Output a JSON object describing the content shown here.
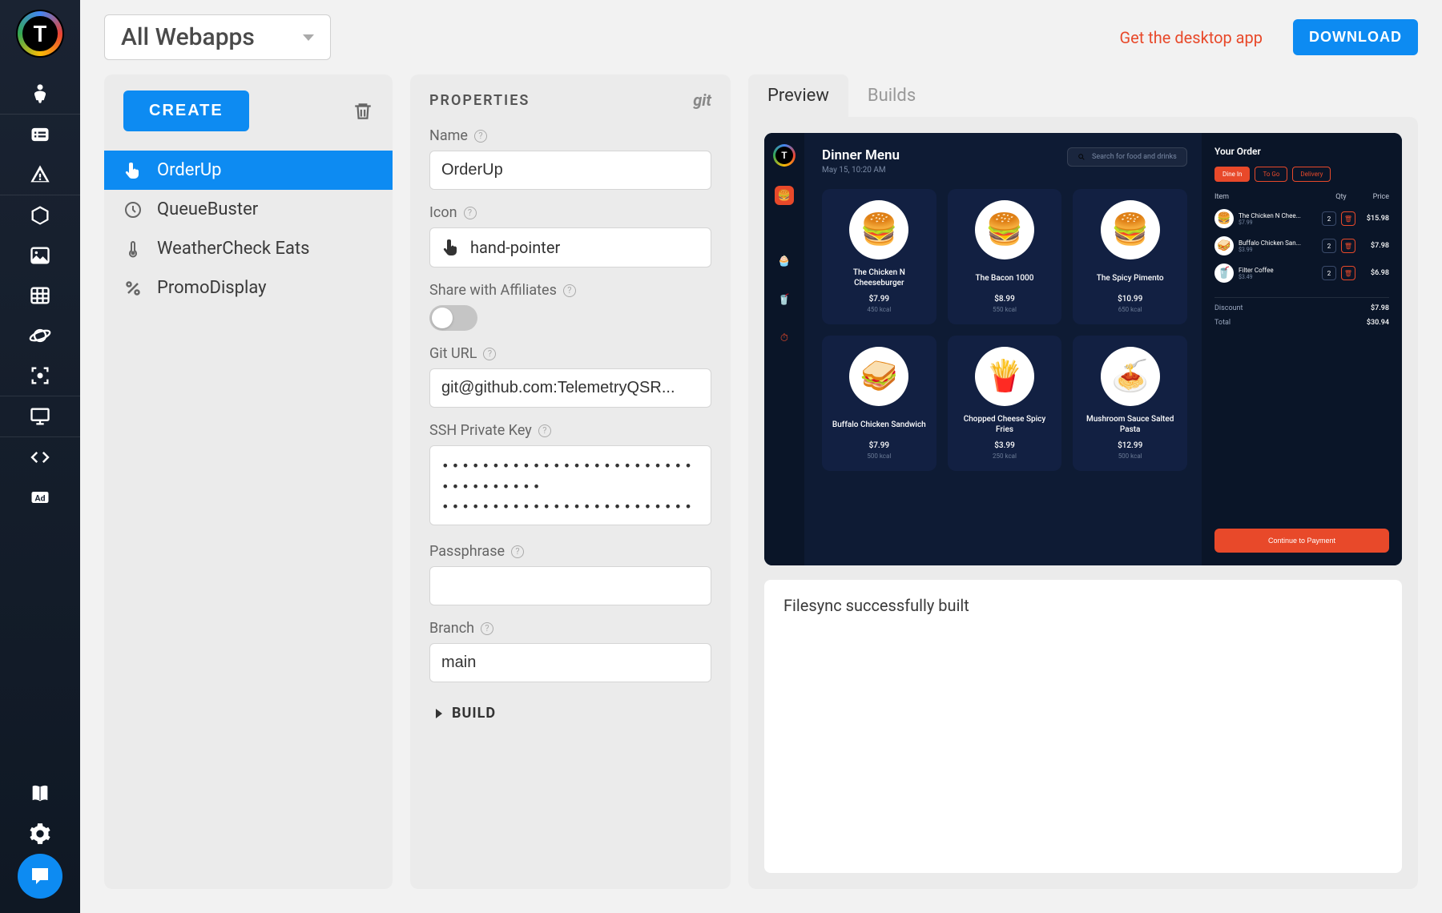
{
  "topbar": {
    "dropdown_label": "All Webapps",
    "desktop_link": "Get the desktop app",
    "download_btn": "DOWNLOAD"
  },
  "applist": {
    "create_btn": "CREATE",
    "items": [
      {
        "icon": "hand-pointer",
        "label": "OrderUp",
        "active": true
      },
      {
        "icon": "clock",
        "label": "QueueBuster"
      },
      {
        "icon": "thermometer",
        "label": "WeatherCheck Eats"
      },
      {
        "icon": "percent",
        "label": "PromoDisplay"
      }
    ]
  },
  "properties": {
    "title": "PROPERTIES",
    "git_label": "git",
    "name_label": "Name",
    "name_value": "OrderUp",
    "icon_label": "Icon",
    "icon_value": "hand-pointer",
    "share_label": "Share with Affiliates",
    "giturl_label": "Git URL",
    "giturl_value": "git@github.com:TelemetryQSR...",
    "ssh_label": "SSH Private Key",
    "ssh_value": "•••••••••••••••••••••••••••••••••••\n•••••••••••••••••••••••••••••••••••\n••••••••••••••••••••••••••••",
    "passphrase_label": "Passphrase",
    "passphrase_value": "",
    "branch_label": "Branch",
    "branch_value": "main",
    "build_label": "BUILD"
  },
  "preview": {
    "tabs": [
      {
        "label": "Preview",
        "active": true
      },
      {
        "label": "Builds"
      }
    ],
    "status_message": "Filesync successfully built",
    "app": {
      "title": "Dinner Menu",
      "date": "May 15, 10:20 AM",
      "search_placeholder": "Search for food and drinks",
      "menu": [
        {
          "emoji": "🍔",
          "name": "The Chicken N Cheeseburger",
          "price": "$7.99",
          "kcal": "450 kcal"
        },
        {
          "emoji": "🍔",
          "name": "The Bacon 1000",
          "price": "$8.99",
          "kcal": "550 kcal"
        },
        {
          "emoji": "🍔",
          "name": "The Spicy Pimento",
          "price": "$10.99",
          "kcal": "650 kcal"
        },
        {
          "emoji": "🥪",
          "name": "Buffalo Chicken Sandwich",
          "price": "$7.99",
          "kcal": "500 kcal"
        },
        {
          "emoji": "🍟",
          "name": "Chopped Cheese Spicy Fries",
          "price": "$3.99",
          "kcal": "250 kcal"
        },
        {
          "emoji": "🍝",
          "name": "Mushroom Sauce Salted Pasta",
          "price": "$12.99",
          "kcal": "500 kcal"
        }
      ],
      "order": {
        "title": "Your Order",
        "tabs": [
          {
            "label": "Dine In",
            "active": true
          },
          {
            "label": "To Go"
          },
          {
            "label": "Delivery"
          }
        ],
        "head_item": "Item",
        "head_qty": "Qty",
        "head_price": "Price",
        "items": [
          {
            "emoji": "🍔",
            "name": "The Chicken N Chee...",
            "sub": "$7.99",
            "qty": "2",
            "price": "$15.98"
          },
          {
            "emoji": "🥪",
            "name": "Buffalo Chicken San...",
            "sub": "$3.99",
            "qty": "2",
            "price": "$7.98"
          },
          {
            "emoji": "🥤",
            "name": "Filter Coffee",
            "sub": "$3.49",
            "qty": "2",
            "price": "$6.98"
          }
        ],
        "discount_label": "Discount",
        "discount_value": "$7.98",
        "total_label": "Total",
        "total_value": "$30.94",
        "continue_btn": "Continue to Payment"
      }
    }
  }
}
